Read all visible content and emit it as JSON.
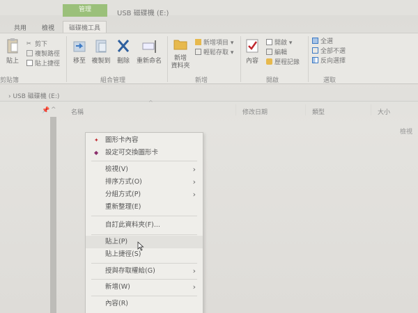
{
  "titlebar": {
    "context_tab": "管理",
    "window_title": "USB 磁碟機 (E:)"
  },
  "ribbon_tabs": [
    "共用",
    "檢視",
    "磁碟機工具"
  ],
  "ribbon": {
    "clipboard": {
      "paste": "貼上",
      "cut": "剪下",
      "copy_path": "複製路徑",
      "paste_shortcut": "貼上捷徑",
      "group": "剪貼簿"
    },
    "organize": {
      "move": "移至",
      "copy": "複製到",
      "delete": "刪除",
      "rename": "重新命名",
      "group": "組合管理"
    },
    "new": {
      "new_folder": "新增\n資料夾",
      "new_item": "新增項目 ▾",
      "easy_access": "輕鬆存取 ▾",
      "group": "新增"
    },
    "open": {
      "properties": "內容",
      "open": "開啟 ▾",
      "edit": "編輯",
      "history": "歷程記錄",
      "group": "開啟"
    },
    "select": {
      "select_all": "全選",
      "select_none": "全部不選",
      "invert": "反向選擇",
      "group": "選取"
    }
  },
  "address": {
    "path": "USB 磁碟機 (E:)"
  },
  "columns": {
    "name": "名稱",
    "date": "修改日期",
    "type": "類型",
    "size": "大小"
  },
  "partial_right_text": "檢視",
  "context_menu": {
    "items": [
      {
        "label": "圖形卡內容",
        "icon": "graphics-icon"
      },
      {
        "label": "設定可交換圖形卡",
        "icon": "switchable-graphics-icon"
      },
      {
        "label": "檢視(V)",
        "submenu": true
      },
      {
        "label": "排序方式(O)",
        "submenu": true
      },
      {
        "label": "分組方式(P)",
        "submenu": true
      },
      {
        "label": "重新整理(E)"
      },
      {
        "label": "自訂此資料夾(F)..."
      },
      {
        "label": "貼上(P)"
      },
      {
        "label": "貼上捷徑(S)"
      },
      {
        "label": "授與存取權給(G)",
        "submenu": true
      },
      {
        "label": "新增(W)",
        "submenu": true
      },
      {
        "label": "內容(R)"
      }
    ]
  },
  "colors": {
    "context_tab": "#9bc07a",
    "accent_icon": "#3b79c4",
    "delete_icon": "#2e5f9e",
    "properties_check": "#c0282d"
  }
}
